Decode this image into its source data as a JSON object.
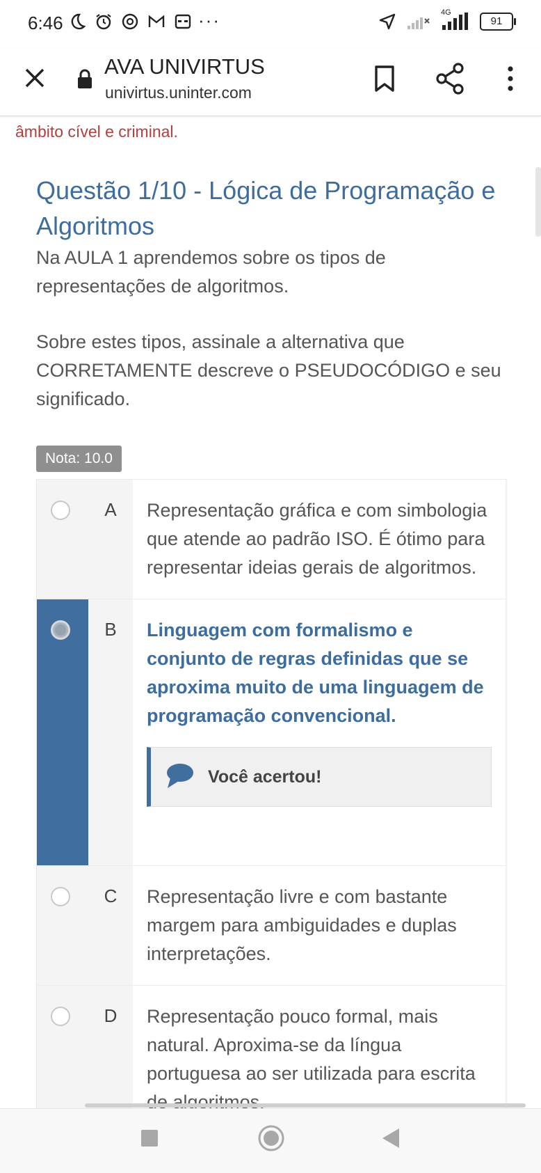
{
  "status_bar": {
    "time": "6:46",
    "network": "4G",
    "battery": "91",
    "more": "···",
    "icons": [
      "moon-icon",
      "alarm-icon",
      "threads-icon",
      "gmail-icon",
      "mask-icon",
      "location-arrow-icon",
      "signal-off-icon",
      "signal-4g-icon",
      "battery-icon"
    ]
  },
  "toolbar": {
    "title": "AVA UNIVIRTUS",
    "url": "univirtus.uninter.com",
    "icons": [
      "close-icon",
      "lock-icon",
      "bookmark-icon",
      "share-icon",
      "more-vert-icon"
    ]
  },
  "content": {
    "warning_tail": "âmbito cível e criminal.",
    "question_title": "Questão 1/10 - Lógica de Programação e Algoritmos",
    "question_text1": "Na AULA 1 aprendemos sobre os tipos de representações de algoritmos.",
    "question_text2": "Sobre estes tipos, assinale a alternativa que CORRETAMENTE descreve o PSEUDOCÓDIGO e seu significado.",
    "grade": "Nota: 10.0"
  },
  "options": [
    {
      "letter": "A",
      "text": "Representação gráfica e com simbologia que atende ao padrão ISO. É ótimo para representar ideias gerais de algoritmos.",
      "selected": false
    },
    {
      "letter": "B",
      "text": "Linguagem com formalismo e conjunto de regras definidas que se aproxima muito de uma linguagem de programação convencional.",
      "selected": true,
      "feedback": "Você acertou!"
    },
    {
      "letter": "C",
      "text": "Representação livre e com bastante margem para ambiguidades e duplas interpretações.",
      "selected": false
    },
    {
      "letter": "D",
      "text": "Representação pouco formal, mais natural. Aproxima-se da língua portuguesa ao ser utilizada para escrita de algoritmos.",
      "selected": false
    }
  ],
  "colors": {
    "accent": "#406e9e",
    "title": "#3d6d9e",
    "warning": "#b04040",
    "grade_bg": "#8f8f8f"
  },
  "nav_bar": {
    "icons": [
      "recents-icon",
      "home-icon",
      "back-icon"
    ]
  }
}
